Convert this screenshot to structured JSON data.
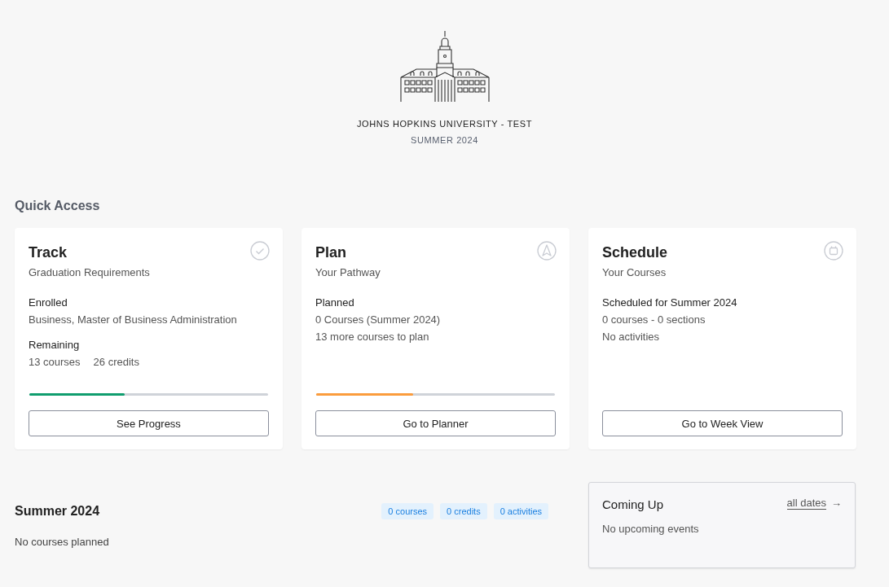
{
  "header": {
    "institution": "JOHNS HOPKINS UNIVERSITY - TEST",
    "term": "SUMMER 2024"
  },
  "quick_access": {
    "heading": "Quick Access",
    "cards": [
      {
        "title": "Track",
        "subtitle": "Graduation Requirements",
        "kind": "track",
        "sections": [
          {
            "label": "Enrolled",
            "lines": [
              [
                "Business, Master of Business Administration"
              ]
            ]
          },
          {
            "label": "Remaining",
            "lines": [
              [
                "13 courses",
                "26 credits"
              ]
            ]
          }
        ],
        "progress": {
          "level": 0.4,
          "color": "#0f9d6e"
        },
        "button": "See Progress"
      },
      {
        "title": "Plan",
        "subtitle": "Your Pathway",
        "kind": "plan",
        "sections": [
          {
            "label": "Planned",
            "lines": [
              [
                "0 Courses (Summer 2024)"
              ],
              [
                "13 more courses to plan"
              ]
            ]
          }
        ],
        "progress": {
          "level": 0.405,
          "color": "#fb9c3c"
        },
        "button": "Go to Planner"
      },
      {
        "title": "Schedule",
        "subtitle": "Your Courses",
        "kind": "schedule",
        "sections": [
          {
            "label": "Scheduled for Summer 2024",
            "lines": [
              [
                "0 courses - 0 sections"
              ],
              [
                "No activities"
              ]
            ]
          }
        ],
        "button": "Go to Week View"
      }
    ]
  },
  "term_summary": {
    "heading": "Summer 2024",
    "badges": [
      "0 courses",
      "0 credits",
      "0 activities"
    ],
    "message": "No courses planned"
  },
  "coming_up": {
    "heading": "Coming Up",
    "link": "all dates",
    "link_icon": "→",
    "message": "No upcoming events"
  }
}
